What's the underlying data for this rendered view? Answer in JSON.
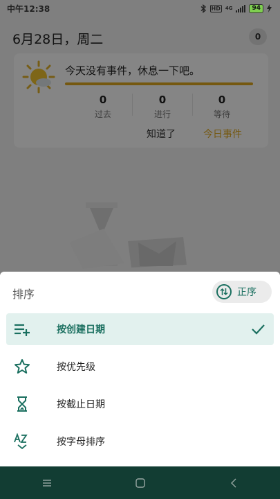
{
  "status_bar": {
    "time": "中午12:38",
    "hd": "HD",
    "network": "4G",
    "battery": "94"
  },
  "header": {
    "date": "6月28日，周二",
    "event_count": "0"
  },
  "card": {
    "message": "今天没有事件，休息一下吧。",
    "stats": [
      {
        "value": "0",
        "label": "过去"
      },
      {
        "value": "0",
        "label": "进行"
      },
      {
        "value": "0",
        "label": "等待"
      }
    ],
    "dismiss_label": "知道了",
    "today_label": "今日事件"
  },
  "sort_sheet": {
    "title": "排序",
    "order_label": "正序",
    "options": [
      {
        "label": "按创建日期",
        "icon": "playlist-add-icon",
        "selected": true
      },
      {
        "label": "按优先级",
        "icon": "star-outline-icon",
        "selected": false
      },
      {
        "label": "按截止日期",
        "icon": "hourglass-icon",
        "selected": false
      },
      {
        "label": "按字母排序",
        "icon": "sort-alphabetical-icon",
        "selected": false
      }
    ]
  },
  "colors": {
    "accent": "#1a6f5f",
    "selected_bg": "#e2f1ee",
    "nav_bar": "#123d33",
    "progress": "#e0a91f",
    "today_button": "#e0a91f"
  },
  "nav_bar": {
    "items": [
      "menu-icon",
      "home-square-icon",
      "back-icon"
    ]
  }
}
